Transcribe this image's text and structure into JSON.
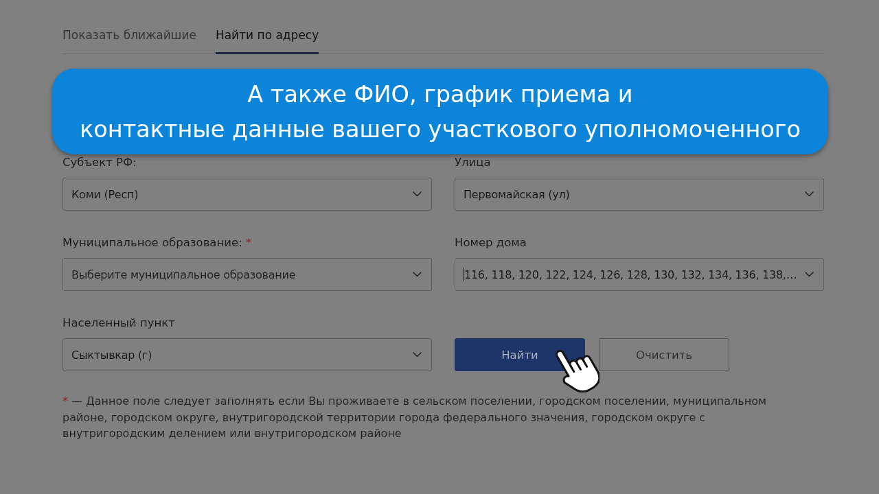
{
  "tabs": [
    {
      "label": "Показать ближайшие",
      "selected": false
    },
    {
      "label": "Найти по адресу",
      "selected": true
    }
  ],
  "caption": {
    "lines": [
      "А также ФИО, график приема и",
      "контактные данные вашего участкового уполномоченного"
    ]
  },
  "fields": [
    {
      "label": "Субъект РФ:",
      "value": "Коми (Респ)",
      "focused": false
    },
    {
      "label": "Улица",
      "value": "Первомайская (ул)",
      "focused": false
    },
    {
      "label": "Муниципальное образование:",
      "required_mark": "*",
      "placeholder": "Выберите муниципальное образование",
      "focused": false
    },
    {
      "label": "Номер дома",
      "value": "116, 118, 120, 122, 124, 126, 128, 130, 132, 134, 136, 138,…",
      "focused": true
    },
    {
      "label": "Населенный пункт",
      "value": "Сыктывкар (г)",
      "focused": false
    }
  ],
  "buttons": [
    {
      "label": "Найти",
      "kind": "primary"
    },
    {
      "label": "Очистить",
      "kind": "secondary"
    }
  ],
  "footnote": {
    "mark": "*",
    "text": "— Данное поле следует заполнять если Вы проживаете в сельском поселении, городском поселении, муниципальном районе, городском округе, внутригородской территории города федерального значения, городском округе с внутригородским делением или внутригородском районе"
  }
}
